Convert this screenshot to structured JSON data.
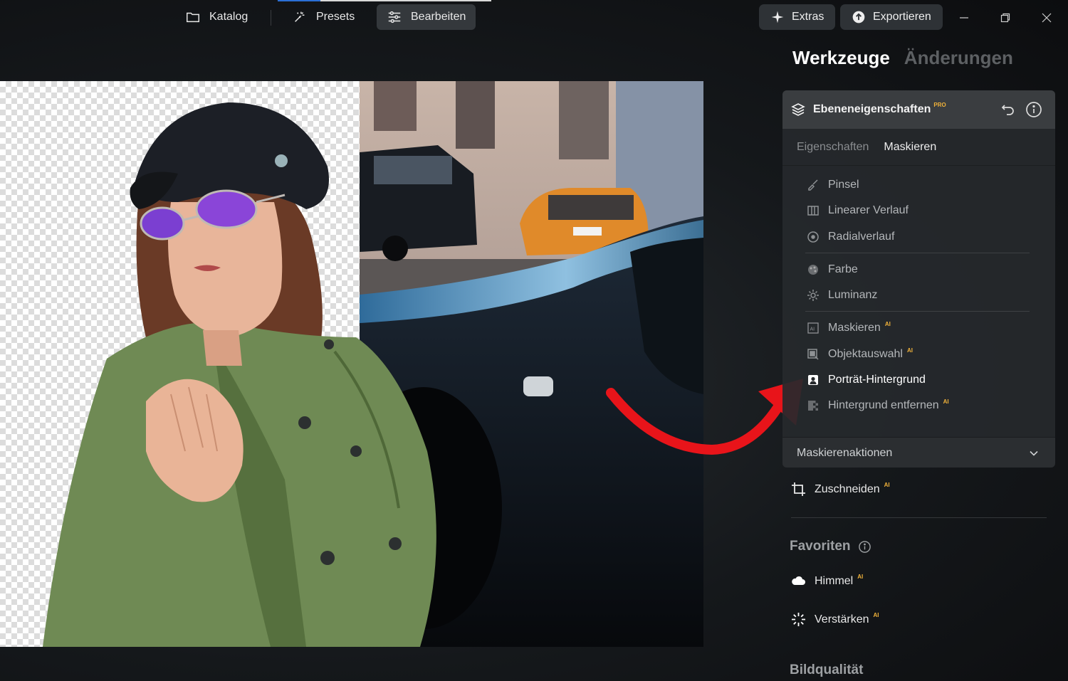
{
  "topbar": {
    "tabs": [
      {
        "label": "Katalog",
        "icon": "folder-icon"
      },
      {
        "label": "Presets",
        "icon": "magic-wand-icon"
      },
      {
        "label": "Bearbeiten",
        "icon": "sliders-icon",
        "active": true
      }
    ],
    "extras_label": "Extras",
    "export_label": "Exportieren"
  },
  "panel": {
    "tabs": {
      "tools": "Werkzeuge",
      "changes": "Änderungen"
    },
    "card": {
      "title": "Ebeneneigenschaften",
      "badge": "PRO",
      "subtabs": {
        "properties": "Eigenschaften",
        "mask": "Maskieren"
      },
      "tools": [
        {
          "label": "Pinsel",
          "icon": "brush-icon"
        },
        {
          "label": "Linearer Verlauf",
          "icon": "linear-gradient-icon"
        },
        {
          "label": "Radialverlauf",
          "icon": "radial-gradient-icon"
        },
        {
          "label": "Farbe",
          "icon": "color-palette-icon"
        },
        {
          "label": "Luminanz",
          "icon": "luminance-icon"
        },
        {
          "label": "Maskieren",
          "icon": "ai-mask-icon",
          "ai": "AI"
        },
        {
          "label": "Objektauswahl",
          "icon": "object-select-icon",
          "ai": "AI"
        },
        {
          "label": "Porträt-Hintergrund",
          "icon": "portrait-icon",
          "selected": true
        },
        {
          "label": "Hintergrund entfernen",
          "icon": "remove-background-icon",
          "ai": "AI"
        }
      ],
      "mask_actions": "Maskierenaktionen"
    },
    "crop": {
      "label": "Zuschneiden",
      "ai": "AI"
    },
    "favorites": {
      "title": "Favoriten",
      "items": [
        {
          "label": "Himmel",
          "ai": "AI",
          "icon": "cloud-icon"
        },
        {
          "label": "Verstärken",
          "ai": "AI",
          "icon": "sparkle-burst-icon"
        }
      ]
    },
    "quality_title": "Bildqualität"
  },
  "colors": {
    "accent_badge": "#f0b23a",
    "annotation_arrow": "#e8141a",
    "panel_bg": "#26292c"
  }
}
